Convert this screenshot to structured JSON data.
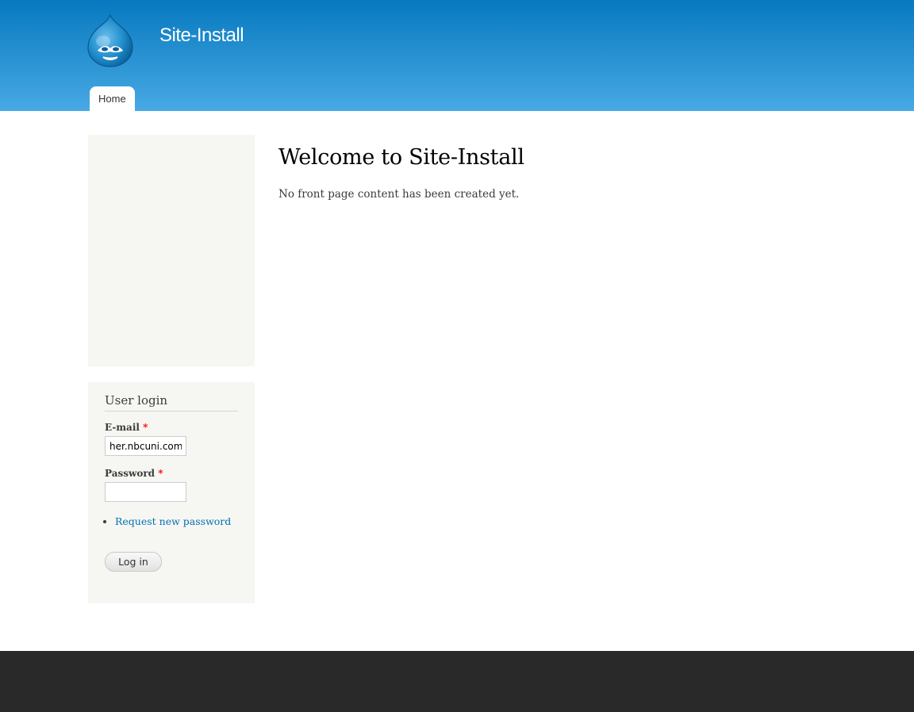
{
  "header": {
    "site_name": "Site-Install",
    "logo_icon": "drupal-drop-logo-icon",
    "menu": [
      {
        "label": "Home"
      }
    ]
  },
  "main": {
    "title": "Welcome to Site-Install",
    "message": "No front page content has been created yet."
  },
  "user_login": {
    "title": "User login",
    "email_label": "E-mail",
    "email_value": "her.nbcuni.com",
    "password_label": "Password",
    "password_value": "",
    "required_marker": "*",
    "request_password_link": "Request new password",
    "login_button": "Log in"
  },
  "colors": {
    "header_top": "#0779bf",
    "header_bottom": "#48a9e4",
    "sidebar_bg": "#f6f6f2",
    "footer_bg": "#292929",
    "link": "#0071b3"
  }
}
